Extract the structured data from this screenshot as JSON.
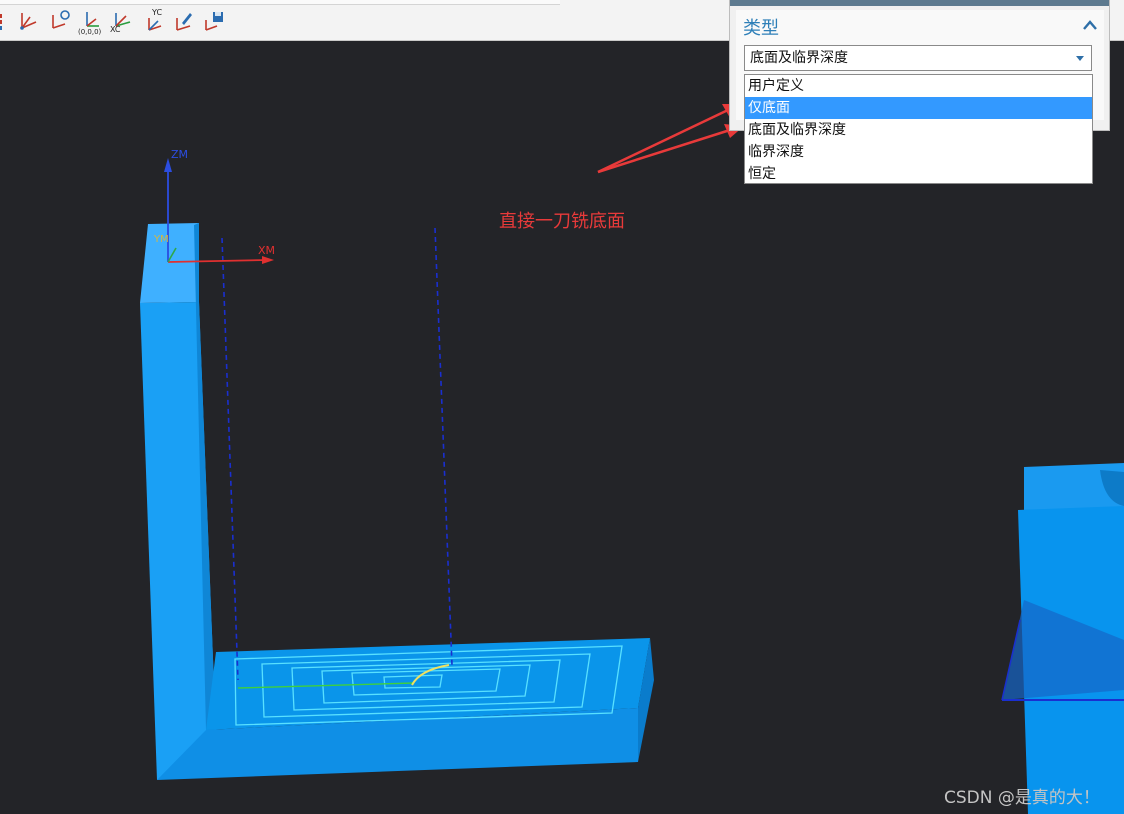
{
  "toolbar": {
    "tools": [
      {
        "icon": "csys-dynamic-icon",
        "label": ""
      },
      {
        "icon": "csys-rotate-icon",
        "label": ""
      },
      {
        "icon": "csys-origin-icon",
        "label": "(0,0,0)"
      },
      {
        "icon": "csys-xc-icon",
        "label": "XC"
      },
      {
        "icon": "csys-yc-icon",
        "label": "YC"
      },
      {
        "icon": "csys-orient-icon",
        "label": ""
      },
      {
        "icon": "csys-save-icon",
        "label": ""
      }
    ]
  },
  "panel": {
    "group_title": "类型",
    "selected_value": "底面及临界深度",
    "options": [
      "用户定义",
      "仅底面",
      "底面及临界深度",
      "临界深度",
      "恒定"
    ],
    "highlighted_index": 1
  },
  "viewport": {
    "axes": {
      "z_label": "ZM",
      "x_label": "XM",
      "y_label": "YM"
    },
    "annotation": "直接一刀铣底面",
    "watermark": "CSDN @是真的大！"
  },
  "colors": {
    "background": "#232428",
    "part": "#1a9af0",
    "toolpath": "#58e0ff",
    "annotation": "#e83a3a",
    "highlight": "#3399ff"
  }
}
